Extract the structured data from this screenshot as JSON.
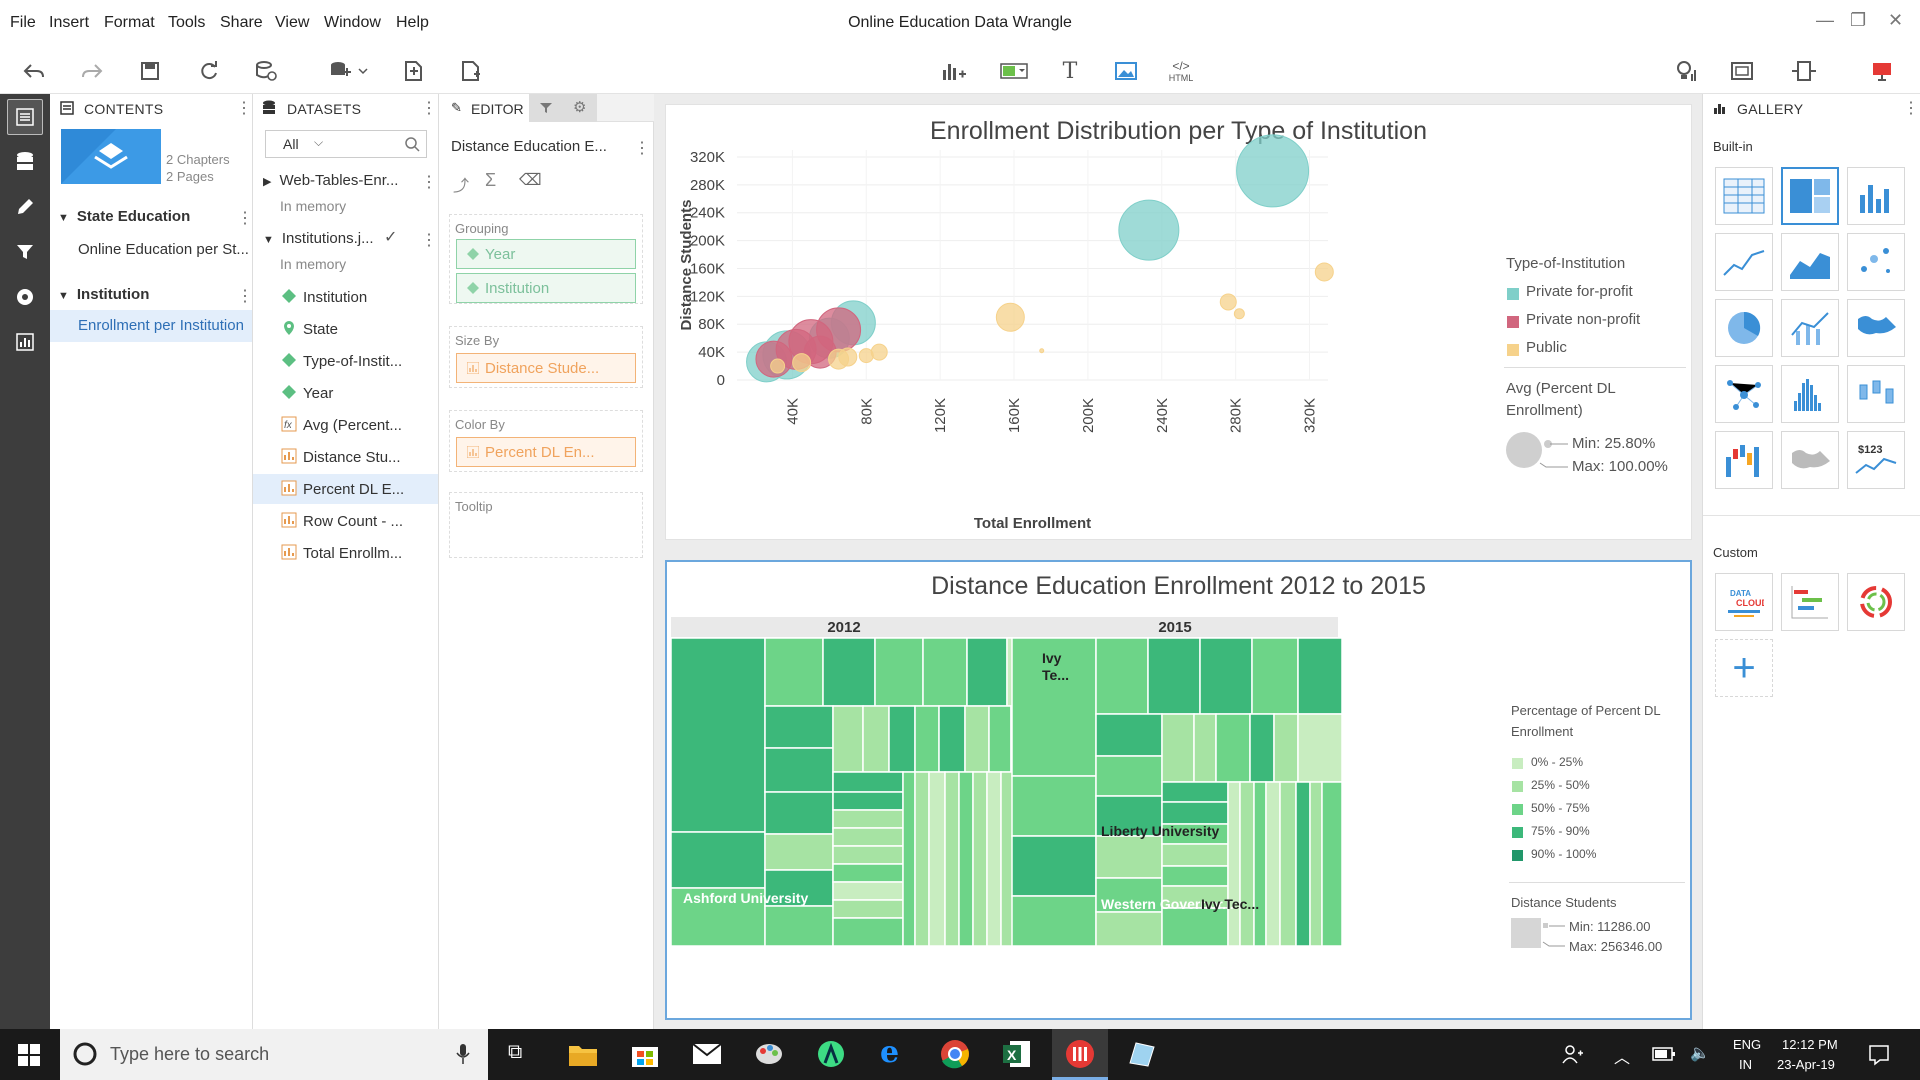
{
  "menu": {
    "file": "File",
    "insert": "Insert",
    "format": "Format",
    "tools": "Tools",
    "share": "Share",
    "view": "View",
    "window": "Window",
    "help": "Help"
  },
  "window_title": "Online Education Data Wrangle",
  "contents": {
    "header": "CONTENTS",
    "story_chapters": "2 Chapters",
    "story_pages": "2 Pages",
    "chapter1": "State Education",
    "chapter1_page": "Online Education per St...",
    "chapter2": "Institution",
    "chapter2_page": "Enrollment per Institution"
  },
  "datasets": {
    "header": "DATASETS",
    "filter_value": "All",
    "ds1_name": "Web-Tables-Enr...",
    "ds1_status": "In memory",
    "ds2_name": "Institutions.j...",
    "ds2_status": "In memory",
    "fields": [
      "Institution",
      "State",
      "Type-of-Instit...",
      "Year",
      "Avg (Percent...",
      "Distance Stu...",
      "Percent DL E...",
      "Row Count - ...",
      "Total Enrollm..."
    ]
  },
  "editor": {
    "tab_editor": "EDITOR",
    "viz_name": "Distance Education E...",
    "grouping_label": "Grouping",
    "grouping_items": [
      "Year",
      "Institution"
    ],
    "sizeby_label": "Size By",
    "sizeby_value": "Distance Stude...",
    "colorby_label": "Color By",
    "colorby_value": "Percent DL En...",
    "tooltip_label": "Tooltip"
  },
  "chart_data": [
    {
      "type": "scatter",
      "title": "Enrollment Distribution per Type of Institution",
      "xlabel": "Total Enrollment",
      "ylabel": "Distance Students",
      "x_ticks": [
        "40K",
        "80K",
        "120K",
        "160K",
        "200K",
        "240K",
        "280K",
        "320K"
      ],
      "y_ticks": [
        "320K",
        "280K",
        "240K",
        "200K",
        "160K",
        "120K",
        "80K",
        "40K",
        "0"
      ],
      "xlim": [
        10000,
        330000
      ],
      "ylim": [
        0,
        330000
      ],
      "legend_title": "Type-of-Institution",
      "size_legend_title": "Avg (Percent DL Enrollment)",
      "size_min": "Min: 25.80%",
      "size_max": "Max: 100.00%",
      "series": [
        {
          "name": "Private for-profit",
          "color": "#7fcfc9",
          "points": [
            [
              300000,
              300000,
              36
            ],
            [
              233000,
              215000,
              30
            ],
            [
              73000,
              82000,
              22
            ],
            [
              60000,
              60000,
              20
            ],
            [
              37000,
              36000,
              24
            ],
            [
              26000,
              26000,
              20
            ]
          ]
        },
        {
          "name": "Private non-profit",
          "color": "#d1667e",
          "points": [
            [
              65000,
              72000,
              22
            ],
            [
              50000,
              55000,
              22
            ],
            [
              42000,
              44000,
              20
            ],
            [
              30000,
              30000,
              18
            ],
            [
              55000,
              40000,
              16
            ]
          ]
        },
        {
          "name": "Public",
          "color": "#f6d28b",
          "points": [
            [
              158000,
              90000,
              14
            ],
            [
              328000,
              155000,
              9
            ],
            [
              276000,
              112000,
              8
            ],
            [
              282000,
              95000,
              5
            ],
            [
              175000,
              42000,
              2
            ],
            [
              87000,
              40000,
              8
            ],
            [
              80000,
              35000,
              7
            ],
            [
              70000,
              33000,
              9
            ],
            [
              65000,
              30000,
              10
            ],
            [
              45000,
              25000,
              9
            ],
            [
              32000,
              20000,
              7
            ]
          ]
        }
      ]
    },
    {
      "type": "treemap",
      "title": "Distance Education Enrollment 2012 to 2015",
      "groups": [
        "2012",
        "2015"
      ],
      "tile_labels_2012": [
        "Ivy Te...",
        "Ashford University",
        "Liberty University"
      ],
      "tile_labels_2015": [
        "Liberty University",
        "Western Governor...",
        "Ivy Tec..."
      ],
      "legend_title": "Percentage of Percent DL Enrollment",
      "legend_items": [
        {
          "label": "0% - 25%",
          "color": "#c8edc0"
        },
        {
          "label": "25% - 50%",
          "color": "#a6e3a3"
        },
        {
          "label": "50% - 75%",
          "color": "#6dd488"
        },
        {
          "label": "75% - 90%",
          "color": "#3cb87a"
        },
        {
          "label": "90% - 100%",
          "color": "#21976a"
        }
      ],
      "size_title": "Distance Students",
      "size_min": "Min: 11286.00",
      "size_max": "Max: 256346.00"
    }
  ],
  "gallery": {
    "header": "GALLERY",
    "builtin": "Built-in",
    "custom": "Custom"
  },
  "taskbar": {
    "search_placeholder": "Type here to search",
    "lang": "ENG",
    "region": "IN",
    "time": "12:12 PM",
    "date": "23-Apr-19"
  }
}
